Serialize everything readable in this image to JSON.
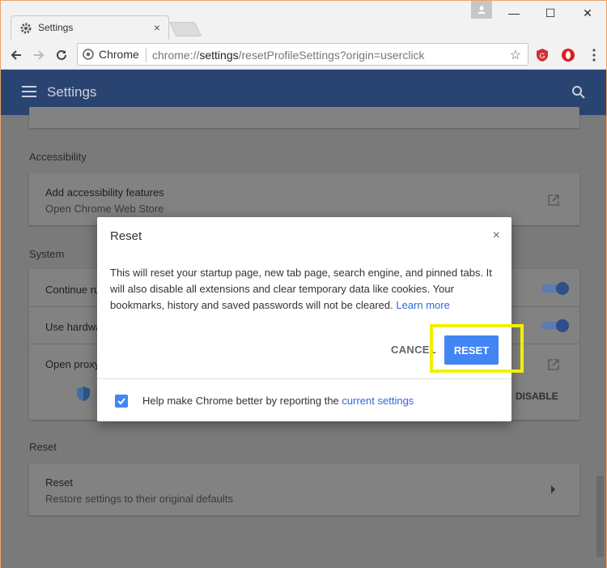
{
  "browser": {
    "tab_title": "Settings",
    "tab_close": "×",
    "omnibox_chip": "Chrome",
    "url_prefix": "chrome://",
    "url_host": "settings",
    "url_rest": "/resetProfileSettings?origin=userclick",
    "window_controls": {
      "minimize": "—",
      "maximize": "☐",
      "close": "✕"
    }
  },
  "appbar": {
    "title": "Settings"
  },
  "settings": {
    "accessibility": {
      "header": "Accessibility",
      "row_title": "Add accessibility features",
      "row_sub": "Open Chrome Web Store"
    },
    "system": {
      "header": "System",
      "rows": [
        {
          "label": "Continue ru"
        },
        {
          "label": "Use hardwa"
        },
        {
          "label": "Open proxy"
        }
      ],
      "disable_label": "DISABLE"
    },
    "reset": {
      "header": "Reset",
      "row_title": "Reset",
      "row_sub": "Restore settings to their original defaults"
    }
  },
  "dialog": {
    "title": "Reset",
    "close": "×",
    "body": "This will reset your startup page, new tab page, search engine, and pinned tabs. It will also disable all extensions and clear temporary data like cookies. Your bookmarks, history and saved passwords will not be cleared.",
    "learn_more": "Learn more",
    "cancel": "CANCEL",
    "reset": "RESET",
    "footer_text": "Help make Chrome better by reporting the",
    "footer_link": "current settings",
    "report_checked": true
  },
  "colors": {
    "appbar": "#2a4472",
    "accent": "#4285f4",
    "highlight": "#f2f000",
    "link": "#3367d6"
  }
}
